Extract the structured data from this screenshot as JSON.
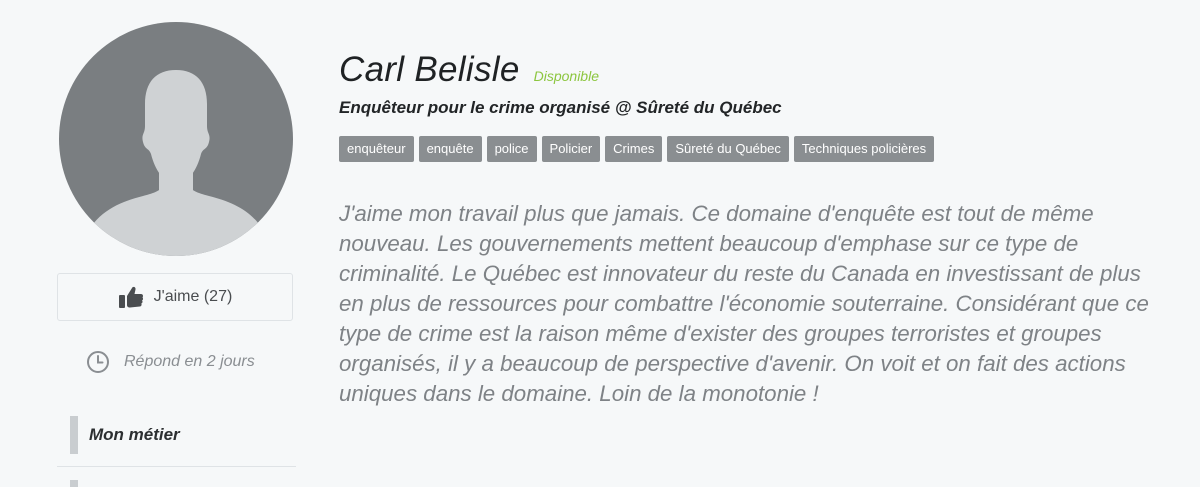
{
  "profile": {
    "name": "Carl Belisle",
    "status": "Disponible",
    "title": "Enquêteur pour le crime organisé @ Sûreté du Québec",
    "tags": [
      "enquêteur",
      "enquête",
      "police",
      "Policier",
      "Crimes",
      "Sûreté du Québec",
      "Techniques policières"
    ],
    "bio": "J'aime mon travail plus que jamais. Ce domaine d'enquête est tout de même nouveau. Les gouvernements mettent beaucoup d'emphase sur ce type de criminalité. Le Québec est innovateur du reste du Canada en investissant de plus en plus de ressources pour combattre l'économie souterraine. Considérant que ce type de crime est la raison même d'exister des groupes terroristes et groupes organisés, il y a beaucoup de perspective d'avenir. On voit et on fait des actions uniques dans le domaine. Loin de la monotonie !"
  },
  "sidebar": {
    "avatar_icon": "default-user-silhouette",
    "like_label": "J'aime (27)",
    "like_icon": "thumbs-up-icon",
    "response_label": "Répond en 2 jours",
    "response_icon": "clock-icon",
    "nav_items": [
      {
        "label": "Mon métier"
      }
    ]
  },
  "colors": {
    "status": "#8cc63f",
    "tag_bg": "#8a8e91",
    "bio_text": "#7e8286",
    "avatar_bg": "#7a7e81",
    "avatar_silhouette": "#cfd2d4"
  }
}
